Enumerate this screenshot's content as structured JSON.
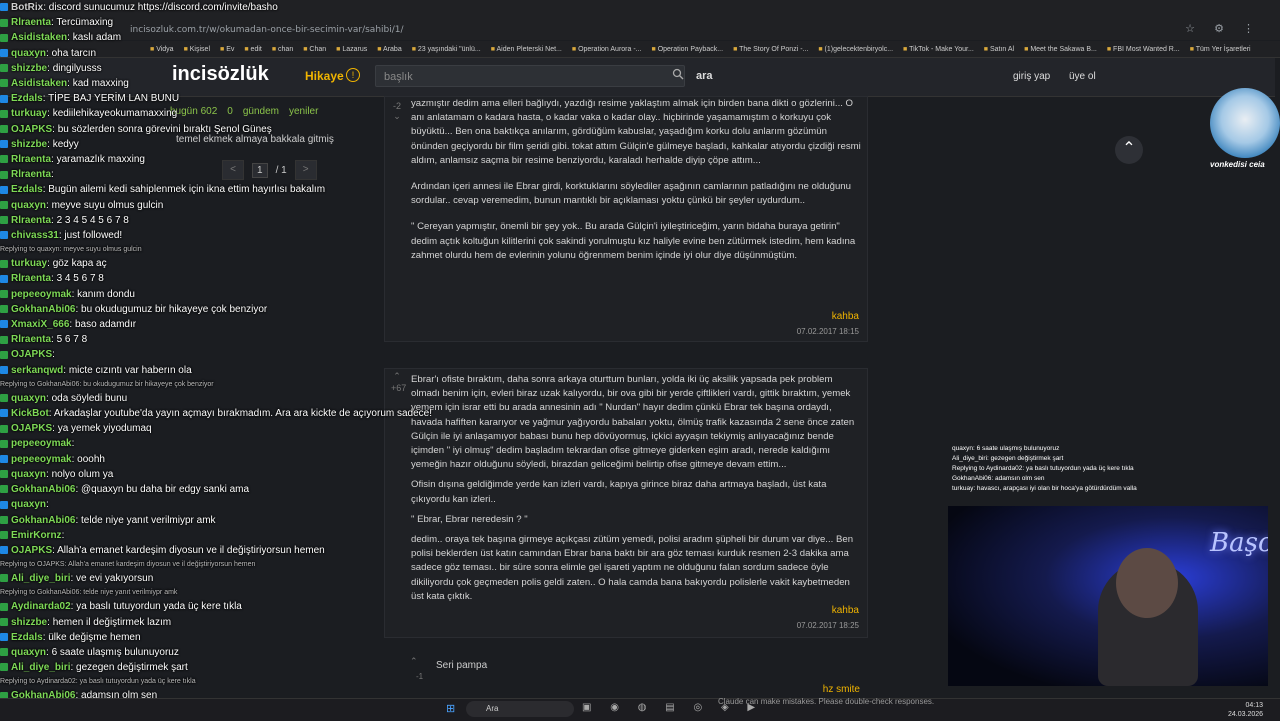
{
  "browser": {
    "url": "incisozluk.com.tr/w/okumadan-once-bir-secimin-var/sahibi/1/",
    "bookmarks": [
      "Vidya",
      "Kişisel",
      "Ev",
      "edit",
      "chan",
      "Chan",
      "Lazarus",
      "Araba",
      "23 yaşındaki \"ünlü...",
      "Aiden Pleterski Net...",
      "Operation Aurora -...",
      "Operation Payback...",
      "The Story Of Ponzi -...",
      "(1)gelecektenbiryolc...",
      "TikTok - Make Your...",
      "Satın Al",
      "Meet the Sakawa B...",
      "FBI Most Wanted R...",
      "Tüm Yer İşaretleri"
    ]
  },
  "site": {
    "logo": "incisözlük",
    "category": "Hikaye",
    "search_placeholder": "başlık",
    "search_button": "ara",
    "login": "giriş yap",
    "register": "üye ol"
  },
  "sidebar": {
    "stats": [
      "bugün 602",
      "0",
      "gündem",
      "yeniler"
    ],
    "topic_title": "temel ekmek almaya bakkala gitmiş",
    "pager": {
      "prev": "<",
      "current": "1",
      "total": "/ 1",
      "next": ">"
    }
  },
  "entries": [
    {
      "vote_up": "-2",
      "paragraphs": [
        "yazmıştır dedim ama elleri bağlıydı, yazdığı resime yaklaştım almak için birden bana dikti o gözlerini... O anı anlatamam o kadara hasta, o kadar vaka o kadar olay.. hiçbirinde yaşamamıştım o korkuyu çok büyüktü... Ben ona baktıkça anılarım, gördüğüm kabuslar, yaşadığım korku dolu anlarım gözümün önünden geçiyordu bir film şeridi gibi. tokat attım Gülçin'e gülmeye başladı, kahkalar atıyordu çizdiği resmi aldım, anlamsız saçma bir resime benziyordu, karaladı herhalde diyip çöpe attım...",
        "Ardından içeri annesi ile Ebrar girdi, korktuklarını söylediler aşağının camlarının patladığını ne olduğunu sordular.. cevap veremedim, bunun mantıklı bir açıklaması yoktu çünkü bir şeyler uydurdum..",
        "\" Cereyan yapmıştır, önemli bir şey yok.. Bu arada Gülçin'i iyileştiriceğim, yarın bidaha buraya getirin\" dedim açtık koltuğun kilitlerini çok sakindi yorulmuştu kız haliyle evine ben zütürmek istedim, hem kadına zahmet olurdu hem de evlerinin yolunu öğrenmem benim içinde iyi olur diye düşünmüştüm."
      ],
      "author": "kahba",
      "date": "07.02.2017 18:15"
    },
    {
      "vote_up": "+67",
      "paragraphs": [
        "Ebrar'ı ofiste bıraktım, daha sonra arkaya oturttum bunları, yolda iki üç aksilik yapsada pek problem olmadı benim için, evleri biraz uzak kalıyordu, bir ova gibi bir yerde çiftlikleri vardı, gittik bıraktım, yemek yemem için israr etti bu arada annesinin adı \" Nurdan\" hayır dedim çünkü Ebrar tek başına ordaydı, havada hafiften kararıyor ve yağmur yağıyordu babaları yoktu, ölmüş trafik kazasında 2 sene önce zaten Gülçin ile iyi anlaşamıyor babası bunu hep dövüyormuş, içkici ayyaşın tekiymiş anlıyacağınız bende içimden \" iyi olmuş\" dedim başladım tekrardan ofise gitmeye giderken eşim aradı, nerede kaldığımı yemeğin hazır olduğunu söyledi, birazdan geliceğimi belirtip ofise gitmeye devam ettim...",
        "Ofisin dışına geldiğimde yerde kan izleri vardı, kapıya girince biraz daha artmaya başladı, üst kata çıkıyordu kan izleri..",
        "\" Ebrar, Ebrar neredesin ? \"",
        "dedim.. oraya tek başına girmeye açıkçası zütüm yemedi, polisi aradım şüpheli bir durum var diye... Ben polisi beklerden üst katın camından Ebrar bana baktı bir ara göz teması kurduk resmen 2-3 dakika ama sadece göz teması.. bir süre sonra elimle gel işareti yaptım ne olduğunu falan sordum sadece öyle dikiliyordu çok geçmeden polis geldi zaten.. O hala camda bana bakıyordu polislerle vakit kaybetmeden üst kata çıktık."
      ],
      "author": "kahba",
      "date": "07.02.2017 18:25"
    }
  ],
  "comment": {
    "text": "Seri pampa",
    "vote": "-1",
    "author": "hz smite"
  },
  "chat": [
    {
      "user": "BotRix",
      "color": "#cfcfcf",
      "msg": "discord sunucumuz https://discord.com/invite/basho"
    },
    {
      "user": "Rlraenta",
      "color": "#7ed957",
      "msg": "Tercümaxing"
    },
    {
      "user": "Asidistaken",
      "color": "#7ed957",
      "msg": "kaslı adam"
    },
    {
      "user": "quaxyn",
      "color": "#7ed957",
      "msg": "oha tarcın"
    },
    {
      "user": "shizzbe",
      "color": "#7ed957",
      "msg": "dingilyusss"
    },
    {
      "user": "Asidistaken",
      "color": "#7ed957",
      "msg": "kad maxxing"
    },
    {
      "user": "Ezdals",
      "color": "#7ed957",
      "msg": "TİPE BAJ YERİM LAN BUNU"
    },
    {
      "user": "turkuay",
      "color": "#7ed957",
      "msg": "kediilehikayeokumamaxxing"
    },
    {
      "user": "OJAPKS",
      "color": "#7ed957",
      "msg": "bu sözlerden sonra görevini bıraktı Şenol Güneş"
    },
    {
      "user": "shizzbe",
      "color": "#7ed957",
      "msg": "kedyy"
    },
    {
      "user": "Rlraenta",
      "color": "#7ed957",
      "msg": "yaramazlık maxxing"
    },
    {
      "user": "Rlraenta",
      "color": "#7ed957",
      "msg": ""
    },
    {
      "user": "Ezdals",
      "color": "#7ed957",
      "msg": "Bugün ailemi kedi sahiplenmek için ikna ettim hayırlısı bakalım"
    },
    {
      "user": "quaxyn",
      "color": "#7ed957",
      "msg": "meyve suyu olmus gulcin"
    },
    {
      "user": "Rlraenta",
      "color": "#7ed957",
      "msg": "2 3 4 5 4 5 6 7 8"
    },
    {
      "user": "chivass31",
      "color": "#7ed957",
      "msg": "just followed!"
    },
    {
      "reply": "Replying to quaxyn: meyve suyu olmus gulcin"
    },
    {
      "user": "turkuay",
      "color": "#7ed957",
      "msg": "göz kapa aç"
    },
    {
      "user": "Rlraenta",
      "color": "#7ed957",
      "msg": "3 4 5 6 7 8"
    },
    {
      "user": "pepeeoymak",
      "color": "#7ed957",
      "msg": "kanım dondu"
    },
    {
      "user": "GokhanAbi06",
      "color": "#7ed957",
      "msg": "bu okudugumuz bir hikayeye çok benziyor"
    },
    {
      "user": "XmaxiX_666",
      "color": "#7ed957",
      "msg": "baso adamdır"
    },
    {
      "user": "Rlraenta",
      "color": "#7ed957",
      "msg": "5 6 7 8"
    },
    {
      "user": "OJAPKS",
      "color": "#7ed957",
      "msg": ""
    },
    {
      "user": "serkanqwd",
      "color": "#7ed957",
      "msg": "micte cızıntı var haberın ola"
    },
    {
      "reply": "Replying to GokhanAbi06: bu okudugumuz bir hikayeye çok benziyor"
    },
    {
      "user": "quaxyn",
      "color": "#7ed957",
      "msg": "oda söyledi bunu"
    },
    {
      "user": "KickBot",
      "color": "#7ed957",
      "msg": "Arkadaşlar youtube'da yayın açmayı bırakmadım. Ara ara kickte de açıyorum sadece!"
    },
    {
      "user": "OJAPKS",
      "color": "#7ed957",
      "msg": "ya yemek yiyodumaq"
    },
    {
      "user": "pepeeoymak",
      "color": "#7ed957",
      "msg": ""
    },
    {
      "user": "pepeeoymak",
      "color": "#7ed957",
      "msg": "ooohh"
    },
    {
      "user": "quaxyn",
      "color": "#7ed957",
      "msg": "nolyo olum ya"
    },
    {
      "user": "GokhanAbi06",
      "color": "#7ed957",
      "msg": "@quaxyn bu daha bir edgy sanki ama"
    },
    {
      "user": "quaxyn",
      "color": "#7ed957",
      "msg": ""
    },
    {
      "user": "GokhanAbi06",
      "color": "#7ed957",
      "msg": "telde niye yanıt verilmiypr amk"
    },
    {
      "user": "EmirKornz",
      "color": "#7ed957",
      "msg": ""
    },
    {
      "user": "OJAPKS",
      "color": "#7ed957",
      "msg": "Allah'a emanet kardeşim diyosun ve il değiştiriyorsun hemen"
    },
    {
      "reply": "Replying to OJAPKS: Allah'a emanet kardeşim diyosun ve il değiştiriyorsun hemen"
    },
    {
      "user": "Ali_diye_biri",
      "color": "#7ed957",
      "msg": "ve evi yakıyorsun"
    },
    {
      "reply": "Replying to GokhanAbi06: telde niye yanıt verilmiypr amk"
    },
    {
      "user": "Aydinarda02",
      "color": "#7ed957",
      "msg": "ya baslı tutuyordun yada üç kere tıkla"
    },
    {
      "user": "shizzbe",
      "color": "#7ed957",
      "msg": "hemen il değiştirmek lazım"
    },
    {
      "user": "Ezdals",
      "color": "#7ed957",
      "msg": "ülke değişme hemen"
    },
    {
      "user": "quaxyn",
      "color": "#7ed957",
      "msg": "6 saate ulaşmış bulunuyoruz"
    },
    {
      "user": "Ali_diye_biri",
      "color": "#7ed957",
      "msg": "gezegen değiştirmek şart"
    },
    {
      "reply": "Replying to Aydinarda02: ya baslı tutuyordun yada üç kere tıkla"
    },
    {
      "user": "GokhanAbi06",
      "color": "#7ed957",
      "msg": "adamsın olm sen"
    },
    {
      "user": "turkuay",
      "color": "#7ed957",
      "msg": "havascı, arapçası iyi olan bir hoca'ya götürdürdüm valla"
    }
  ],
  "cam_chat": [
    "quaxyn: 6 saate ulaşmış bulunuyoruz",
    "Ali_diye_biri: gezegen değiştirmek şart",
    "Replying to Aydinarda02: ya baslı tutuyordun yada üç kere tıkla",
    "GokhanAbi06: adamsın olm sen",
    "turkuay: havascı, arapçası iyi olan bir hoca'ya götürdürdüm valla"
  ],
  "overlay": {
    "cam_label": "Başo",
    "avatar_label": "vonkedisi ceia"
  },
  "taskbar": {
    "search": "Ara",
    "toast": "Claude can make mistakes. Please double-check responses.",
    "time": "04:13",
    "date": "24.03.2026"
  }
}
